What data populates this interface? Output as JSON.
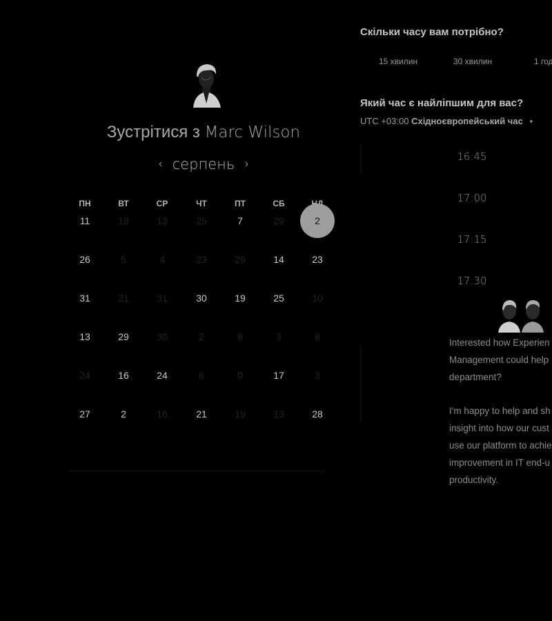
{
  "booking": {
    "host_avatar_icon": "person-avatar-icon",
    "title_prefix": "Зустрітися з",
    "host_name": "Marc Wilson"
  },
  "calendar": {
    "month": "серпень",
    "prev_icon": "chevron-left-icon",
    "next_icon": "chevron-right-icon",
    "weekdays": [
      "ПН",
      "ВТ",
      "СР",
      "ЧТ",
      "ПТ",
      "СБ",
      "НД"
    ],
    "weeks": [
      [
        {
          "d": "11"
        },
        {
          "d": "18",
          "dim": true
        },
        {
          "d": "13",
          "dim": true
        },
        {
          "d": "25",
          "dim": true
        },
        {
          "d": "7"
        },
        {
          "d": "29",
          "dim": true
        },
        {
          "d": "2",
          "selected": true
        }
      ],
      [
        {
          "d": "26"
        },
        {
          "d": "5",
          "dim": true
        },
        {
          "d": "4",
          "dim": true
        },
        {
          "d": "23",
          "dim": true
        },
        {
          "d": "29",
          "dim": true
        },
        {
          "d": "14"
        },
        {
          "d": "23"
        }
      ],
      [
        {
          "d": "31"
        },
        {
          "d": "21",
          "dim": true
        },
        {
          "d": "31",
          "dim": true
        },
        {
          "d": "30"
        },
        {
          "d": "19"
        },
        {
          "d": "25"
        },
        {
          "d": "10",
          "dim": true
        }
      ],
      [
        {
          "d": "13"
        },
        {
          "d": "29"
        },
        {
          "d": "30",
          "dim": true
        },
        {
          "d": "2",
          "dim": true
        },
        {
          "d": "8",
          "dim": true
        },
        {
          "d": "3",
          "dim": true
        },
        {
          "d": "8",
          "dim": true
        }
      ],
      [
        {
          "d": "24",
          "dim": true
        },
        {
          "d": "16"
        },
        {
          "d": "24"
        },
        {
          "d": "6",
          "dim": true
        },
        {
          "d": "0",
          "dim": true
        },
        {
          "d": "17"
        },
        {
          "d": "3",
          "dim": true
        }
      ],
      [
        {
          "d": "27"
        },
        {
          "d": "2"
        },
        {
          "d": "16",
          "dim": true
        },
        {
          "d": "21"
        },
        {
          "d": "19",
          "dim": true
        },
        {
          "d": "13",
          "dim": true
        },
        {
          "d": "28"
        }
      ]
    ]
  },
  "duration": {
    "heading": "Скільки часу вам потрібно?",
    "options": [
      "15 хвилин",
      "30 хвилин",
      "1 год"
    ]
  },
  "time_picker": {
    "heading": "Який час є найліпшим для вас?",
    "timezone_offset": "UTC +03:00",
    "timezone_name": "Східноєвропейський час",
    "timezone_caret_icon": "caret-down-icon",
    "slots": [
      "16:45",
      "17:00",
      "17:15",
      "17:30"
    ]
  },
  "promo": {
    "avatars_icon": "team-avatars-icon",
    "paragraph_1": [
      "Interested how Experien",
      "Management could help",
      "department?"
    ],
    "paragraph_2": [
      "I'm happy to help and sh",
      "insight into how our cust",
      "use our platform to achie",
      "improvement in IT end-u",
      "productivity."
    ]
  }
}
